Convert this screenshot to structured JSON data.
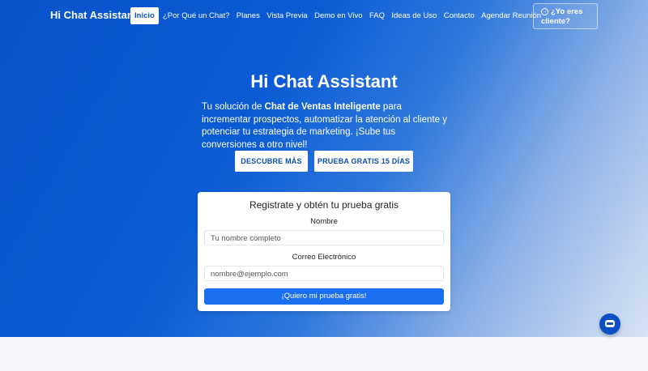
{
  "nav": {
    "brand": "Hi Chat Assistant",
    "links": [
      {
        "label": "Inicio"
      },
      {
        "label": "¿Por Qué un Chat?"
      },
      {
        "label": "Planes"
      },
      {
        "label": "Vista Previa"
      },
      {
        "label": "Demo en Vivo"
      },
      {
        "label": "FAQ"
      },
      {
        "label": "Ideas de Uso"
      },
      {
        "label": "Contacto"
      },
      {
        "label": "Agendar Reunión"
      }
    ],
    "active_index": 0,
    "client_button": {
      "line1": "¿Yo eres",
      "line2": "cliente?",
      "icon": "arrow-circle-icon"
    }
  },
  "hero": {
    "title": "Hi Chat Assistant",
    "desc_prefix": "Tu solución de ",
    "desc_bold": "Chat de Ventas Inteligente",
    "desc_suffix": " para incrementar prospectos, automatizar la atención al cliente y potenciar tu estrategia de marketing. ¡Sube tus conversiones a otro nivel!",
    "btn_discover": "DESCUBRE MÁS",
    "btn_trial": "PRUEBA GRATIS 15 DÍAS"
  },
  "form": {
    "title": "Registrate y obtén tu prueba gratis",
    "name_label": "Nombre",
    "name_placeholder": "Tu nombre completo",
    "email_label": "Correo Electrónico",
    "email_placeholder": "nombre@ejemplo.com",
    "submit_label": "¡Quiero mi prueba gratis!"
  },
  "colors": {
    "primary": "#0b57d0",
    "submit": "#1a6ef0"
  },
  "chat_widget": {
    "icon": "chatbot-icon"
  }
}
